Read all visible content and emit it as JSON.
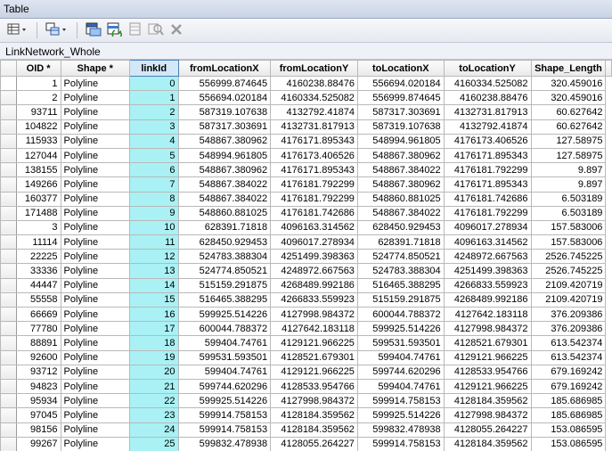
{
  "window": {
    "title": "Table"
  },
  "toolbar": {
    "items": [
      "table-options-icon",
      "related-tables-icon",
      "select-by-attributes-icon",
      "switch-selection-icon",
      "clear-selection-icon",
      "zoom-to-selected-icon",
      "delete-selected-icon"
    ]
  },
  "tab": {
    "label": "LinkNetwork_Whole"
  },
  "table": {
    "columns": [
      "OID *",
      "Shape *",
      "linkId",
      "fromLocationX",
      "fromLocationY",
      "toLocationX",
      "toLocationY",
      "Shape_Length"
    ],
    "rows": [
      [
        "1",
        "Polyline",
        "0",
        "556999.874645",
        "4160238.88476",
        "556694.020184",
        "4160334.525082",
        "320.459016"
      ],
      [
        "2",
        "Polyline",
        "1",
        "556694.020184",
        "4160334.525082",
        "556999.874645",
        "4160238.88476",
        "320.459016"
      ],
      [
        "93711",
        "Polyline",
        "2",
        "587319.107638",
        "4132792.41874",
        "587317.303691",
        "4132731.817913",
        "60.627642"
      ],
      [
        "104822",
        "Polyline",
        "3",
        "587317.303691",
        "4132731.817913",
        "587319.107638",
        "4132792.41874",
        "60.627642"
      ],
      [
        "115933",
        "Polyline",
        "4",
        "548867.380962",
        "4176171.895343",
        "548994.961805",
        "4176173.406526",
        "127.58975"
      ],
      [
        "127044",
        "Polyline",
        "5",
        "548994.961805",
        "4176173.406526",
        "548867.380962",
        "4176171.895343",
        "127.58975"
      ],
      [
        "138155",
        "Polyline",
        "6",
        "548867.380962",
        "4176171.895343",
        "548867.384022",
        "4176181.792299",
        "9.897"
      ],
      [
        "149266",
        "Polyline",
        "7",
        "548867.384022",
        "4176181.792299",
        "548867.380962",
        "4176171.895343",
        "9.897"
      ],
      [
        "160377",
        "Polyline",
        "8",
        "548867.384022",
        "4176181.792299",
        "548860.881025",
        "4176181.742686",
        "6.503189"
      ],
      [
        "171488",
        "Polyline",
        "9",
        "548860.881025",
        "4176181.742686",
        "548867.384022",
        "4176181.792299",
        "6.503189"
      ],
      [
        "3",
        "Polyline",
        "10",
        "628391.71818",
        "4096163.314562",
        "628450.929453",
        "4096017.278934",
        "157.583006"
      ],
      [
        "11114",
        "Polyline",
        "11",
        "628450.929453",
        "4096017.278934",
        "628391.71818",
        "4096163.314562",
        "157.583006"
      ],
      [
        "22225",
        "Polyline",
        "12",
        "524783.388304",
        "4251499.398363",
        "524774.850521",
        "4248972.667563",
        "2526.745225"
      ],
      [
        "33336",
        "Polyline",
        "13",
        "524774.850521",
        "4248972.667563",
        "524783.388304",
        "4251499.398363",
        "2526.745225"
      ],
      [
        "44447",
        "Polyline",
        "14",
        "515159.291875",
        "4268489.992186",
        "516465.388295",
        "4266833.559923",
        "2109.420719"
      ],
      [
        "55558",
        "Polyline",
        "15",
        "516465.388295",
        "4266833.559923",
        "515159.291875",
        "4268489.992186",
        "2109.420719"
      ],
      [
        "66669",
        "Polyline",
        "16",
        "599925.514226",
        "4127998.984372",
        "600044.788372",
        "4127642.183118",
        "376.209386"
      ],
      [
        "77780",
        "Polyline",
        "17",
        "600044.788372",
        "4127642.183118",
        "599925.514226",
        "4127998.984372",
        "376.209386"
      ],
      [
        "88891",
        "Polyline",
        "18",
        "599404.74761",
        "4129121.966225",
        "599531.593501",
        "4128521.679301",
        "613.542374"
      ],
      [
        "92600",
        "Polyline",
        "19",
        "599531.593501",
        "4128521.679301",
        "599404.74761",
        "4129121.966225",
        "613.542374"
      ],
      [
        "93712",
        "Polyline",
        "20",
        "599404.74761",
        "4129121.966225",
        "599744.620296",
        "4128533.954766",
        "679.169242"
      ],
      [
        "94823",
        "Polyline",
        "21",
        "599744.620296",
        "4128533.954766",
        "599404.74761",
        "4129121.966225",
        "679.169242"
      ],
      [
        "95934",
        "Polyline",
        "22",
        "599925.514226",
        "4127998.984372",
        "599914.758153",
        "4128184.359562",
        "185.686985"
      ],
      [
        "97045",
        "Polyline",
        "23",
        "599914.758153",
        "4128184.359562",
        "599925.514226",
        "4127998.984372",
        "185.686985"
      ],
      [
        "98156",
        "Polyline",
        "24",
        "599914.758153",
        "4128184.359562",
        "599832.478938",
        "4128055.264227",
        "153.086595"
      ],
      [
        "99267",
        "Polyline",
        "25",
        "599832.478938",
        "4128055.264227",
        "599914.758153",
        "4128184.359562",
        "153.086595"
      ]
    ],
    "selected_column": "linkId"
  },
  "colors": {
    "selected_column_fill": "#a9f1f4",
    "title_bar": "#d3dbe9",
    "grid_line": "#b9b9b9"
  }
}
